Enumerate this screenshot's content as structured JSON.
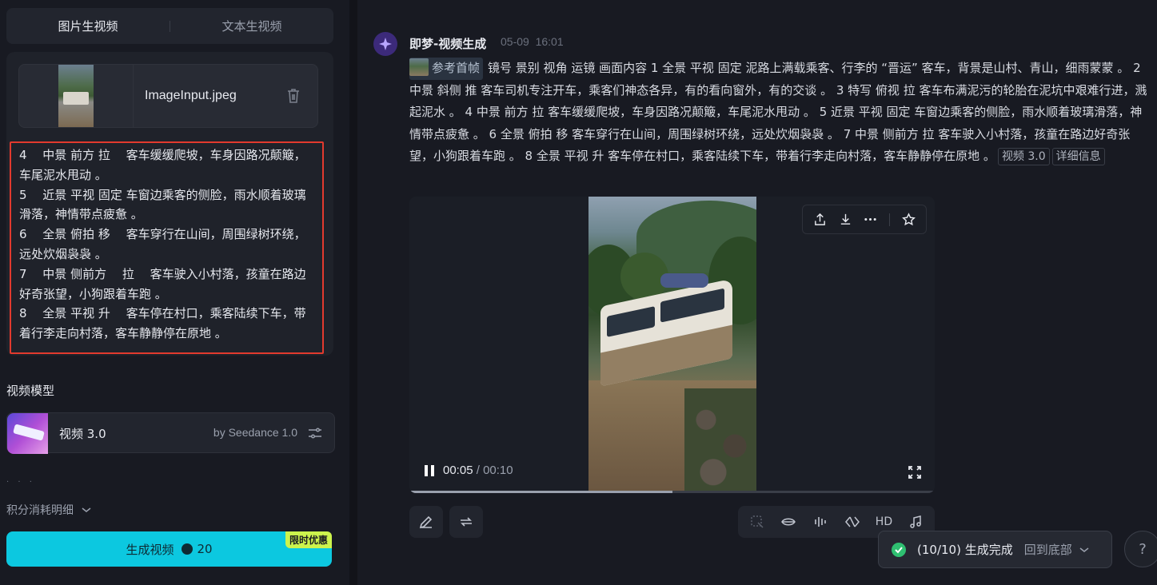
{
  "tabs": [
    {
      "label": "图片生视频",
      "active": true
    },
    {
      "label": "文本生视频",
      "active": false
    }
  ],
  "upload": {
    "file_name": "ImageInput.jpeg"
  },
  "prompt_lines": [
    "4　 中景 前方 拉　 客车缓缓爬坡，车身因路况颠簸，车尾泥水甩动 。",
    "5　 近景 平视 固定 车窗边乘客的侧脸，雨水顺着玻璃滑落，神情带点疲惫 。",
    "6　 全景 俯拍 移　 客车穿行在山间，周围绿树环绕，远处炊烟袅袅 。",
    "7　 中景 侧前方　 拉　 客车驶入小村落，孩童在路边好奇张望，小狗跟着车跑 。",
    "8　 全景 平视 升　 客车停在村口，乘客陆续下车，带着行李走向村落，客车静静停在原地 。"
  ],
  "model_section": {
    "label": "视频模型"
  },
  "model": {
    "name": "视频 3.0",
    "by": "by Seedance 1.0"
  },
  "credits_label": "积分消耗明细",
  "generate": {
    "label": "生成视频",
    "cost": "20",
    "promo": "限时优惠"
  },
  "message": {
    "title": "即梦-视频生成",
    "date": "05-09",
    "time": "16:01",
    "ref_label": "参考首帧",
    "body": "镜号 景别 视角 运镜 画面内容 1 全景 平视 固定 泥路上满载乘客、行李的 “晋运” 客车，背景是山村、青山，细雨蒙蒙 。 2 中景 斜侧 推 客车司机专注开车，乘客们神态各异，有的看向窗外，有的交谈 。 3 特写 俯视 拉 客车布满泥污的轮胎在泥坑中艰难行进，溅起泥水 。 4 中景 前方 拉 客车缓缓爬坡，车身因路况颠簸，车尾泥水甩动 。 5 近景 平视 固定 车窗边乘客的侧脸，雨水顺着玻璃滑落，神情带点疲惫 。 6 全景 俯拍 移 客车穿行在山间，周围绿树环绕，远处炊烟袅袅 。 7 中景 侧前方 拉 客车驶入小村落，孩童在路边好奇张望，小狗跟着车跑 。 8 全景 平视 升 客车停在村口，乘客陆续下车，带着行李走向村落，客车静静停在原地 。",
    "tag_model": "视频 3.0",
    "tag_detail": "详细信息"
  },
  "player": {
    "current": "00:05",
    "separator": "/",
    "total": "00:10",
    "progress": 0.5
  },
  "actions": {
    "hd_label": "HD"
  },
  "status": {
    "text": "(10/10) 生成完成",
    "back_label": "回到底部"
  },
  "help": "?",
  "colors": {
    "accent": "#0cc8e0",
    "promo": "#ccf34d",
    "highlight_border": "#e23a2e",
    "success": "#2fbf71"
  }
}
